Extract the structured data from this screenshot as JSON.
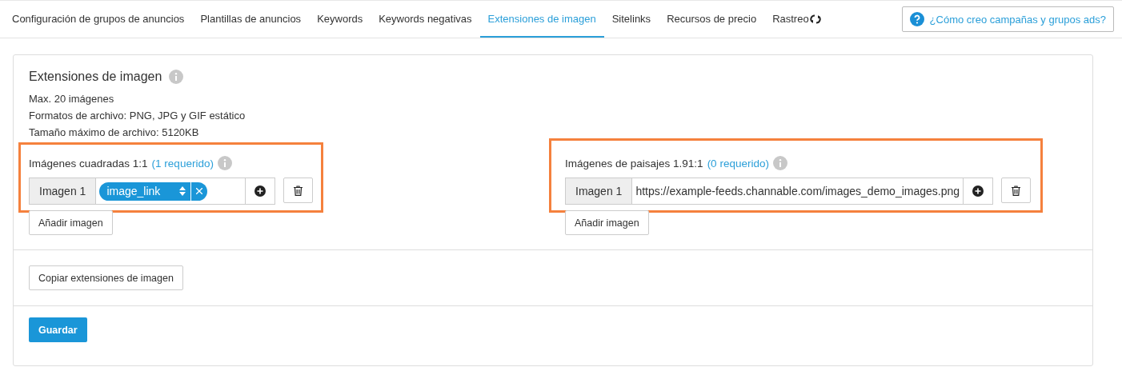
{
  "tabs": [
    {
      "label": "Configuración de grupos de anuncios",
      "selected": false
    },
    {
      "label": "Plantillas de anuncios",
      "selected": false
    },
    {
      "label": "Keywords",
      "selected": false
    },
    {
      "label": "Keywords negativas",
      "selected": false
    },
    {
      "label": "Extensiones de imagen",
      "selected": true
    },
    {
      "label": "Sitelinks",
      "selected": false
    },
    {
      "label": "Recursos de precio",
      "selected": false
    },
    {
      "label": "Rastreo",
      "selected": false
    }
  ],
  "help_button": {
    "label": "¿Cómo creo campañas y grupos ads?"
  },
  "section": {
    "title": "Extensiones de imagen",
    "notes": [
      "Max. 20 imágenes",
      "Formatos de archivo: PNG, JPG y GIF estático",
      "Tamaño máximo de archivo: 5120KB"
    ]
  },
  "groups": [
    {
      "label": "Imágenes cuadradas 1:1",
      "required": "(1 requerido)",
      "highlighted": true,
      "images": [
        {
          "label": "Imagen 1",
          "kind": "tag",
          "value": "image_link"
        }
      ],
      "add_button": "Añadir imagen"
    },
    {
      "label": "Imágenes de paisajes 1.91:1",
      "required": "(0 requerido)",
      "highlighted": true,
      "images": [
        {
          "label": "Imagen 1",
          "kind": "url",
          "value": "https://example-feeds.channable.com/images_demo_images.png"
        }
      ],
      "add_button": "Añadir imagen"
    }
  ],
  "copy_button": "Copiar extensiones de imagen",
  "save_button": "Guardar"
}
